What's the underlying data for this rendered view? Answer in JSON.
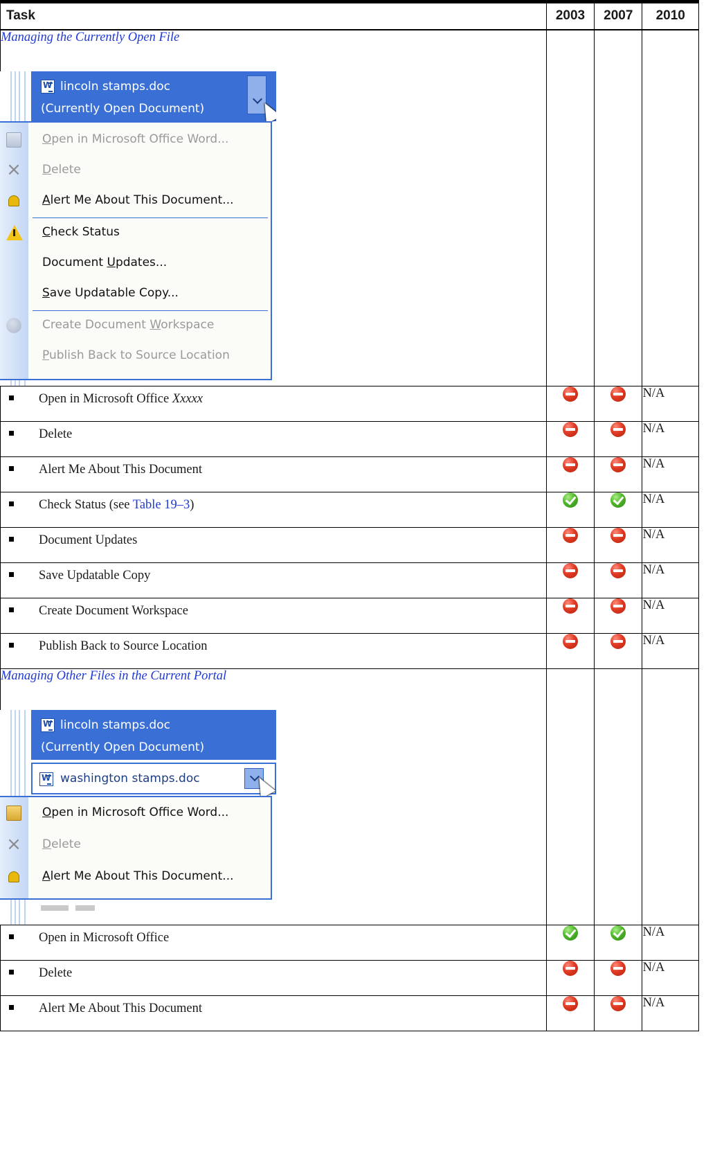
{
  "columns": [
    "Task",
    "2003",
    "2007",
    "2010"
  ],
  "section1": {
    "title": "Managing the Currently Open File",
    "screenshot": {
      "doc_name": "lincoln stamps.doc",
      "doc_status": "(Currently Open Document)",
      "menu_items": [
        {
          "label": "Open in Microsoft Office Word...",
          "access": "O",
          "enabled": false,
          "icon": "folder-icon"
        },
        {
          "label": "Delete",
          "access": "D",
          "enabled": false,
          "icon": "delete-x-icon"
        },
        {
          "label": "Alert Me About This Document...",
          "access": "A",
          "enabled": true,
          "icon": "alert-bell-icon"
        },
        {
          "label": "Check Status",
          "access": "C",
          "enabled": true,
          "icon": "warning-icon"
        },
        {
          "label": "Document Updates...",
          "access": "U",
          "enabled": true,
          "icon": ""
        },
        {
          "label": "Save Updatable Copy...",
          "access": "S",
          "enabled": true,
          "icon": ""
        },
        {
          "label": "Create Document Workspace",
          "access": "W",
          "enabled": false,
          "icon": "workspace-people-icon"
        },
        {
          "label": "Publish Back to Source Location",
          "access": "P",
          "enabled": false,
          "icon": ""
        }
      ]
    },
    "rows": [
      {
        "task": "Open in Microsoft Office ",
        "task_em": "Xxxxx",
        "v2003": "no",
        "v2007": "no",
        "v2010": "N/A"
      },
      {
        "task": "Delete",
        "v2003": "no",
        "v2007": "no",
        "v2010": "N/A"
      },
      {
        "task": "Alert Me About This Document",
        "v2003": "no",
        "v2007": "no",
        "v2010": "N/A"
      },
      {
        "task": "Check Status (see ",
        "task_link": "Table 19–3",
        "task_tail": ")",
        "v2003": "yes",
        "v2007": "yes",
        "v2010": "N/A"
      },
      {
        "task": "Document Updates",
        "v2003": "no",
        "v2007": "no",
        "v2010": "N/A"
      },
      {
        "task": "Save Updatable Copy",
        "v2003": "no",
        "v2007": "no",
        "v2010": "N/A"
      },
      {
        "task": "Create Document Workspace",
        "v2003": "no",
        "v2007": "no",
        "v2010": "N/A"
      },
      {
        "task": "Publish Back to Source Location",
        "v2003": "no",
        "v2007": "no",
        "v2010": "N/A"
      }
    ]
  },
  "section2": {
    "title": "Managing Other Files in the Current Portal",
    "screenshot": {
      "doc_name": "lincoln stamps.doc",
      "doc_status": "(Currently Open Document)",
      "other_doc": "washington stamps.doc",
      "menu_items": [
        {
          "label": "Open in Microsoft Office Word...",
          "access": "O",
          "enabled": true,
          "icon": "folder-icon"
        },
        {
          "label": "Delete",
          "access": "D",
          "enabled": false,
          "icon": "delete-x-icon"
        },
        {
          "label": "Alert Me About This Document...",
          "access": "A",
          "enabled": true,
          "icon": "alert-bell-icon"
        }
      ]
    },
    "rows": [
      {
        "task": "Open in Microsoft Office",
        "v2003": "yes",
        "v2007": "yes",
        "v2010": "N/A"
      },
      {
        "task": "Delete",
        "v2003": "no",
        "v2007": "no",
        "v2010": "N/A"
      },
      {
        "task": "Alert Me About This Document",
        "v2003": "no",
        "v2007": "no",
        "v2010": "N/A"
      }
    ]
  },
  "status_colors": {
    "no": "#e03a23",
    "yes": "#4fb62a"
  },
  "link_color": "#1f39d6"
}
